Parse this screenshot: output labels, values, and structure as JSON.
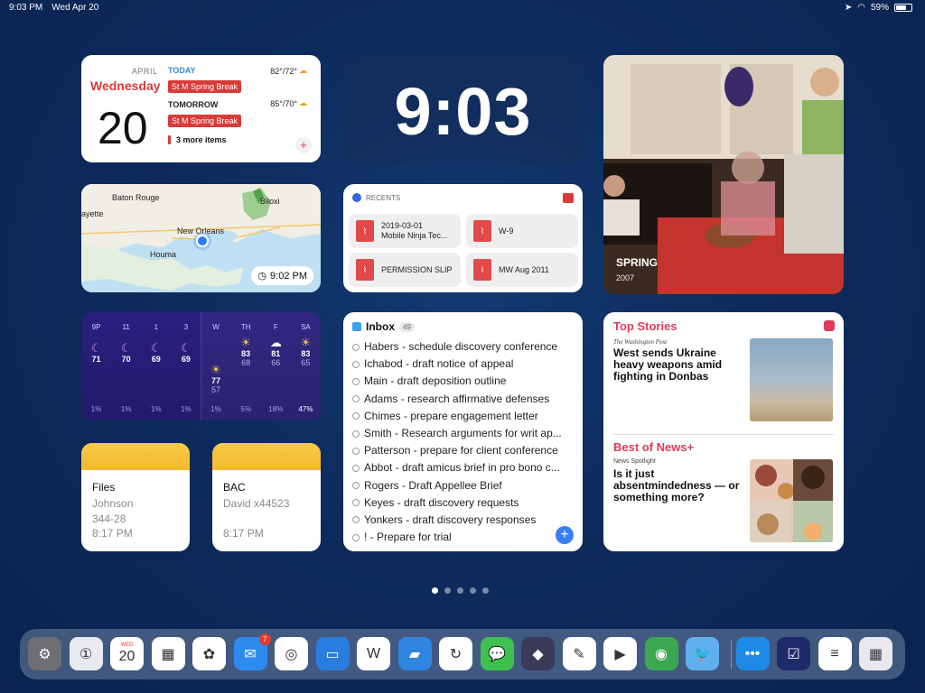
{
  "status": {
    "time": "9:03 PM",
    "date": "Wed Apr 20",
    "battery": "59%",
    "battery_level": 0.59
  },
  "calendar": {
    "month": "APRIL",
    "weekday": "Wednesday",
    "day": "20",
    "today_label": "TODAY",
    "today_temp": "82°/72°",
    "today_event": "St M Spring Break",
    "tomorrow_label": "TOMORROW",
    "tomorrow_temp": "85°/70°",
    "tomorrow_event": "St M Spring Break",
    "more": "3 more items",
    "add": "+"
  },
  "clock": {
    "time": "9:03"
  },
  "photo": {
    "title": "SPRING",
    "year": "2007"
  },
  "map": {
    "cities": {
      "baton_rouge": "Baton Rouge",
      "lafayette": "ayette",
      "new_orleans": "New Orleans",
      "houma": "Houma",
      "biloxi": "Biloxi"
    },
    "time": "9:02 PM"
  },
  "recents": {
    "label": "RECENTS",
    "files": [
      {
        "name": "2019-03-01",
        "name2": "Mobile Ninja Tec..."
      },
      {
        "name": "W-9",
        "name2": ""
      },
      {
        "name": "PERMISSION SLIP",
        "name2": ""
      },
      {
        "name": "MW Aug 2011",
        "name2": ""
      }
    ]
  },
  "weather": {
    "hours": [
      {
        "h": "9P",
        "hi": "71",
        "lo": "",
        "pop": "1%",
        "icon": "☾"
      },
      {
        "h": "11",
        "hi": "70",
        "lo": "",
        "pop": "1%",
        "icon": "☾"
      },
      {
        "h": "1",
        "hi": "69",
        "lo": "",
        "pop": "1%",
        "icon": "☾"
      },
      {
        "h": "3",
        "hi": "69",
        "lo": "",
        "pop": "1%",
        "icon": "☾"
      },
      {
        "h": "W",
        "hi": "77",
        "lo": "57",
        "pop": "1%",
        "icon": "☀"
      },
      {
        "h": "TH",
        "hi": "83",
        "lo": "68",
        "pop": "5%",
        "icon": "☀"
      },
      {
        "h": "F",
        "hi": "81",
        "lo": "66",
        "pop": "18%",
        "icon": "☁"
      },
      {
        "h": "SA",
        "hi": "83",
        "lo": "65",
        "pop": "47%",
        "icon": "☀"
      }
    ]
  },
  "reminders": {
    "title": "Inbox",
    "count": "49",
    "items": [
      "Habers - schedule discovery conference",
      "Ichabod - draft notice of appeal",
      "Main - draft deposition outline",
      "Adams - research affirmative defenses",
      "Chimes - prepare engagement letter",
      "Smith - Research arguments for writ ap...",
      "Patterson - prepare for client conference",
      "Abbot - draft amicus brief in pro bono c...",
      "Rogers - Draft Appellee Brief",
      "Keyes - draft discovery requests",
      "Yonkers - draft discovery responses",
      "! - Prepare for trial"
    ],
    "add": "+"
  },
  "news": {
    "top_label": "Top Stories",
    "top_pub": "The Washington Post",
    "top_headline": "West sends Ukraine heavy weapons amid fighting in Donbas",
    "best_label": "Best of News+",
    "best_pub": "News Spotlight",
    "best_headline": "Is it just absentmindedness — or something more?"
  },
  "notes": [
    {
      "title": "Files",
      "line1": "Johnson",
      "line2": "344-28",
      "time": "8:17 PM"
    },
    {
      "title": "BAC",
      "line1": "David x44523",
      "line2": "",
      "time": "8:17 PM"
    }
  ],
  "dock": {
    "apps": [
      {
        "name": "settings-app",
        "color": "#6e6e73",
        "glyph": "⚙"
      },
      {
        "name": "1password-app",
        "color": "#e8eaf0",
        "glyph": "①"
      },
      {
        "name": "calendar-app",
        "color": "#ffffff",
        "glyph": "20",
        "sub": "WED"
      },
      {
        "name": "fantastical-app",
        "color": "#ffffff",
        "glyph": "▦"
      },
      {
        "name": "photos-app",
        "color": "#ffffff",
        "glyph": "✿"
      },
      {
        "name": "mail-app",
        "color": "#2f8af0",
        "glyph": "✉",
        "badge": "7"
      },
      {
        "name": "safari-app",
        "color": "#ffffff",
        "glyph": "◎"
      },
      {
        "name": "keynote-app",
        "color": "#2a7de0",
        "glyph": "▭"
      },
      {
        "name": "word-app",
        "color": "#ffffff",
        "glyph": "W"
      },
      {
        "name": "files-app",
        "color": "#2f86e0",
        "glyph": "▰"
      },
      {
        "name": "backup-app",
        "color": "#ffffff",
        "glyph": "↻"
      },
      {
        "name": "messages-app",
        "color": "#3ec14f",
        "glyph": "💬"
      },
      {
        "name": "shortcuts-app",
        "color": "#3a3a5a",
        "glyph": "◆"
      },
      {
        "name": "goodnotes-app",
        "color": "#ffffff",
        "glyph": "✎"
      },
      {
        "name": "pdf-app",
        "color": "#ffffff",
        "glyph": "▶"
      },
      {
        "name": "findmy-app",
        "color": "#3aa850",
        "glyph": "◉"
      },
      {
        "name": "tweetbot-app",
        "color": "#5fb0f0",
        "glyph": "🐦"
      },
      {
        "name": "dots-app",
        "color": "#1e8ae8",
        "glyph": "•••"
      },
      {
        "name": "omnifocus-app",
        "color": "#1f2a6a",
        "glyph": "☑"
      },
      {
        "name": "notes-app",
        "color": "#ffffff",
        "glyph": "≡"
      },
      {
        "name": "folder-app",
        "color": "#e8e8ee",
        "glyph": "▦"
      }
    ]
  }
}
